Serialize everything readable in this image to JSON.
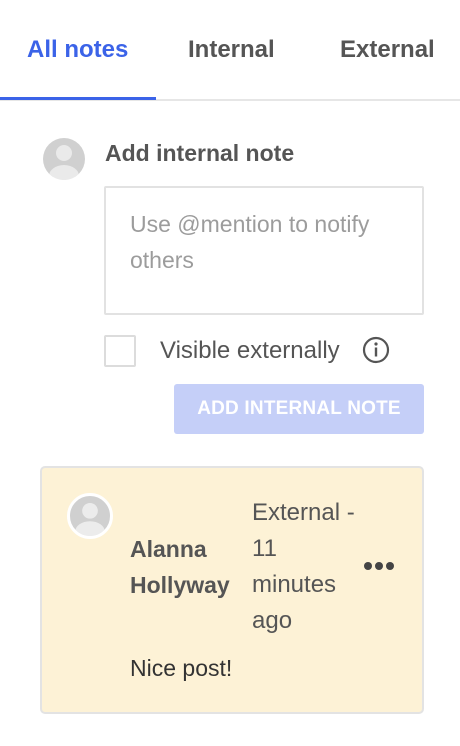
{
  "tabs": [
    {
      "label": "All notes",
      "active": true
    },
    {
      "label": "Internal",
      "active": false
    },
    {
      "label": "External",
      "active": false
    }
  ],
  "compose": {
    "title": "Add internal note",
    "placeholder": "Use @mention to notify others",
    "value": "",
    "visible_externally_label": "Visible externally",
    "visible_externally_checked": false,
    "submit_label": "ADD INTERNAL NOTE"
  },
  "notes": [
    {
      "author": "Alanna Hollyway",
      "meta": "External - 11 minutes ago",
      "body": "Nice post!"
    }
  ],
  "icons": {
    "avatar": "user-avatar-icon",
    "info": "info-icon",
    "more": "more-horizontal-icon"
  },
  "colors": {
    "accent": "#3b63e8",
    "button_disabled": "#c5cff8",
    "note_background": "#fdf2d6"
  }
}
